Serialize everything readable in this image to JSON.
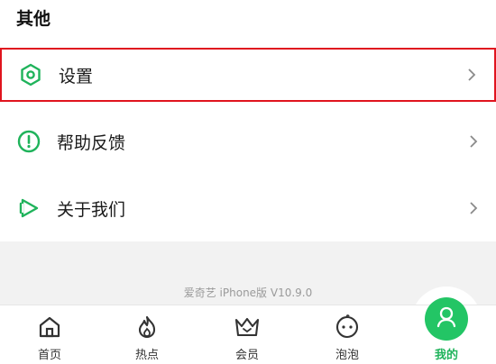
{
  "section": {
    "title": "其他"
  },
  "menu": {
    "items": [
      {
        "label": "设置",
        "icon": "gear-hex-icon"
      },
      {
        "label": "帮助反馈",
        "icon": "exclamation-circle-icon"
      },
      {
        "label": "关于我们",
        "icon": "play-logo-icon"
      }
    ]
  },
  "footer": {
    "version": "爱奇艺 iPhone版 V10.9.0"
  },
  "tabbar": {
    "tabs": [
      {
        "label": "首页",
        "icon": "home-icon",
        "active": false
      },
      {
        "label": "热点",
        "icon": "flame-icon",
        "active": false
      },
      {
        "label": "会员",
        "icon": "crown-icon",
        "active": false
      },
      {
        "label": "泡泡",
        "icon": "bubble-face-icon",
        "active": false
      },
      {
        "label": "我的",
        "icon": "user-icon",
        "active": true
      }
    ]
  },
  "colors": {
    "accent": "#1fb35b",
    "active_bubble": "#23c565",
    "highlight_border": "#e0141e"
  }
}
